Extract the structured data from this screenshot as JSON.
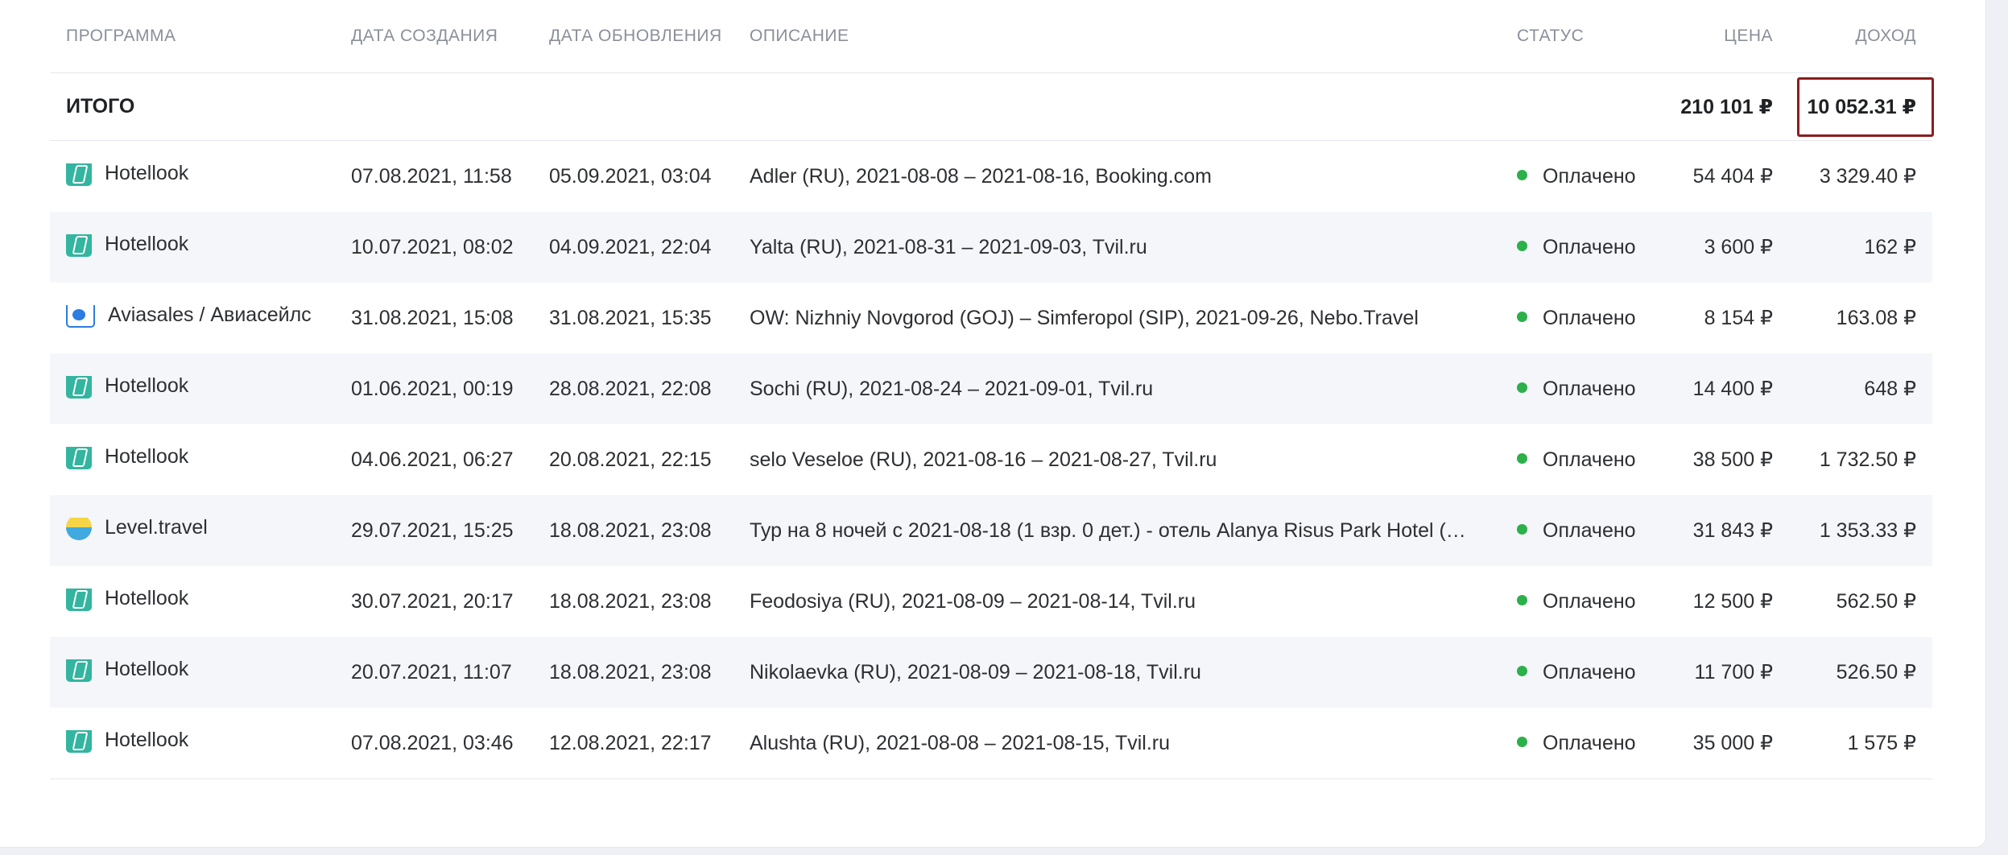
{
  "columns": {
    "program": "ПРОГРАММА",
    "created": "ДАТА СОЗДАНИЯ",
    "updated": "ДАТА ОБНОВЛЕНИЯ",
    "description": "ОПИСАНИЕ",
    "status": "СТАТУС",
    "price": "ЦЕНА",
    "income": "ДОХОД"
  },
  "total": {
    "label": "ИТОГО",
    "price": "210 101 ₽",
    "income": "10 052.31 ₽"
  },
  "colors": {
    "status_paid": "#2bb04a",
    "highlight_border": "#8b1d1d",
    "hotellook_icon": "#33b59f"
  },
  "rows": [
    {
      "program": "Hotellook",
      "icon": "hotellook-icon",
      "created": "07.08.2021, 11:58",
      "updated": "05.09.2021, 03:04",
      "description": "Adler (RU), 2021-08-08 – 2021-08-16, Booking.com",
      "status": "Оплачено",
      "price": "54 404 ₽",
      "income": "3 329.40 ₽"
    },
    {
      "program": "Hotellook",
      "icon": "hotellook-icon",
      "created": "10.07.2021, 08:02",
      "updated": "04.09.2021, 22:04",
      "description": "Yalta (RU), 2021-08-31 – 2021-09-03, Tvil.ru",
      "status": "Оплачено",
      "price": "3 600 ₽",
      "income": "162 ₽"
    },
    {
      "program": "Aviasales / Авиасейлс",
      "icon": "aviasales-icon",
      "created": "31.08.2021, 15:08",
      "updated": "31.08.2021, 15:35",
      "description": "OW: Nizhniy Novgorod (GOJ) – Simferopol (SIP), 2021-09-26, Nebo.Travel",
      "status": "Оплачено",
      "price": "8 154 ₽",
      "income": "163.08 ₽"
    },
    {
      "program": "Hotellook",
      "icon": "hotellook-icon",
      "created": "01.06.2021, 00:19",
      "updated": "28.08.2021, 22:08",
      "description": "Sochi (RU), 2021-08-24 – 2021-09-01, Tvil.ru",
      "status": "Оплачено",
      "price": "14 400 ₽",
      "income": "648 ₽"
    },
    {
      "program": "Hotellook",
      "icon": "hotellook-icon",
      "created": "04.06.2021, 06:27",
      "updated": "20.08.2021, 22:15",
      "description": "selo Veseloe (RU), 2021-08-16 – 2021-08-27, Tvil.ru",
      "status": "Оплачено",
      "price": "38 500 ₽",
      "income": "1 732.50 ₽"
    },
    {
      "program": "Level.travel",
      "icon": "level-travel-icon",
      "created": "29.07.2021, 15:25",
      "updated": "18.08.2021, 23:08",
      "description": "Тур на 8 ночей с 2021-08-18 (1 взр. 0 дет.) - отель Alanya Risus Park Hotel (…",
      "status": "Оплачено",
      "price": "31 843 ₽",
      "income": "1 353.33 ₽"
    },
    {
      "program": "Hotellook",
      "icon": "hotellook-icon",
      "created": "30.07.2021, 20:17",
      "updated": "18.08.2021, 23:08",
      "description": "Feodosiya (RU), 2021-08-09 – 2021-08-14, Tvil.ru",
      "status": "Оплачено",
      "price": "12 500 ₽",
      "income": "562.50 ₽"
    },
    {
      "program": "Hotellook",
      "icon": "hotellook-icon",
      "created": "20.07.2021, 11:07",
      "updated": "18.08.2021, 23:08",
      "description": "Nikolaevka (RU), 2021-08-09 – 2021-08-18, Tvil.ru",
      "status": "Оплачено",
      "price": "11 700 ₽",
      "income": "526.50 ₽"
    },
    {
      "program": "Hotellook",
      "icon": "hotellook-icon",
      "created": "07.08.2021, 03:46",
      "updated": "12.08.2021, 22:17",
      "description": "Alushta (RU), 2021-08-08 – 2021-08-15, Tvil.ru",
      "status": "Оплачено",
      "price": "35 000 ₽",
      "income": "1 575 ₽"
    }
  ]
}
